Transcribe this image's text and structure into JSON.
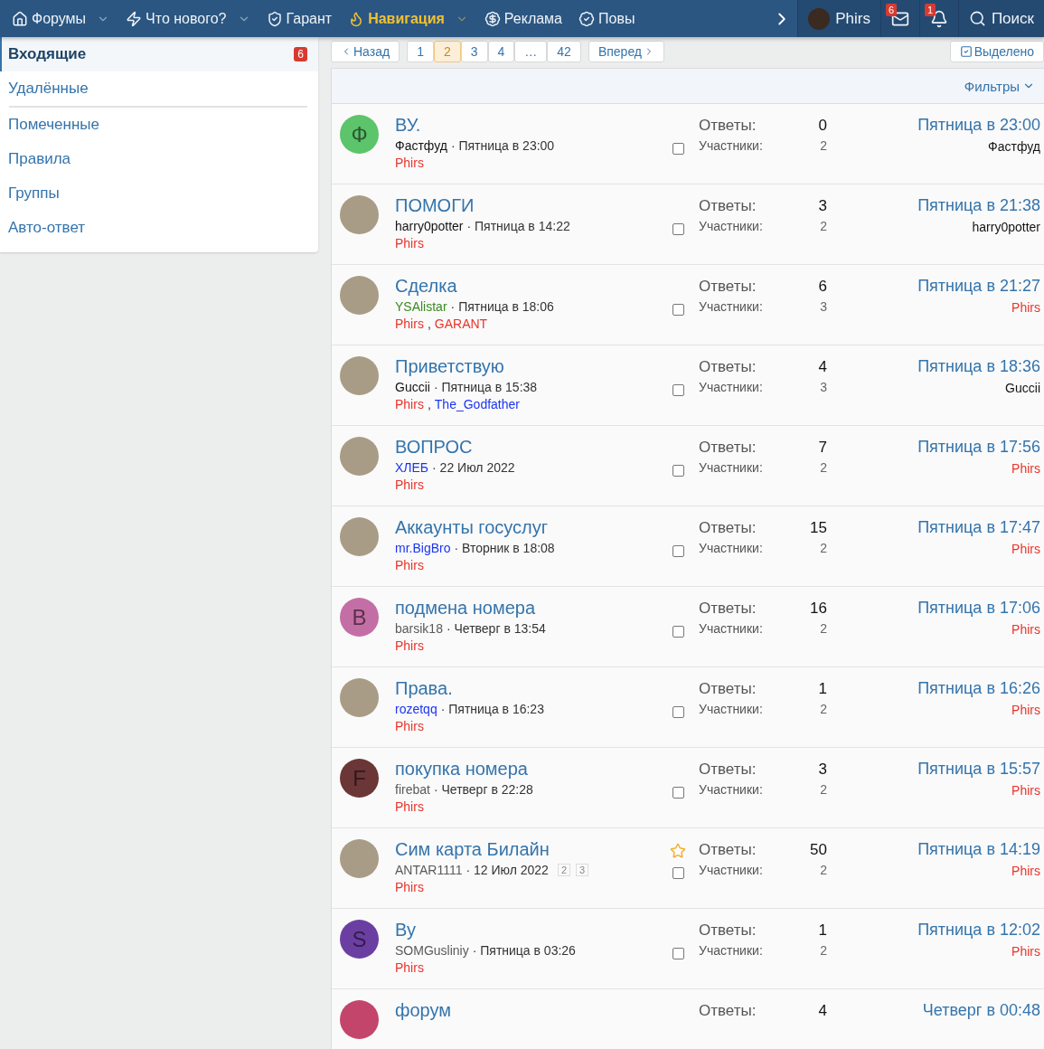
{
  "nav": {
    "items": [
      {
        "label": "Форумы",
        "caret": true,
        "selected": false
      },
      {
        "label": "Что нового?",
        "caret": true,
        "selected": false
      },
      {
        "label": "Гарант",
        "caret": false,
        "selected": false
      },
      {
        "label": "Навигация",
        "caret": true,
        "selected": true
      },
      {
        "label": "Реклама",
        "caret": false,
        "selected": false
      },
      {
        "label": "Повы",
        "caret": false,
        "selected": false
      }
    ],
    "user": {
      "name": "Phirs"
    },
    "messages_badge": "6",
    "alerts_badge": "1",
    "search": "Поиск"
  },
  "sidebar": {
    "items": [
      {
        "label": "Входящие",
        "badge": "6",
        "selected": true
      },
      {
        "label": "Удалённые",
        "selected": false
      },
      {
        "label": "Помеченные",
        "selected": false
      },
      {
        "label": "Правила",
        "selected": false
      },
      {
        "label": "Группы",
        "selected": false
      },
      {
        "label": "Авто-ответ",
        "selected": false
      }
    ]
  },
  "pagination": {
    "prev": "Назад",
    "pages": [
      {
        "label": "1",
        "selected": false
      },
      {
        "label": "2",
        "selected": true
      },
      {
        "label": "3",
        "selected": false
      },
      {
        "label": "4",
        "selected": false
      },
      {
        "label": "…",
        "selected": false
      },
      {
        "label": "42",
        "selected": false
      }
    ],
    "next": "Вперед",
    "selected_button": "Выделено"
  },
  "filters": "Фильтры",
  "rows": [
    {
      "title": "ВУ.",
      "avatar": {
        "kind": "letter",
        "letter": "Ф",
        "color": "#5cc46a"
      },
      "author": {
        "name": "Фастфуд",
        "color": "#141414"
      },
      "date": "· Пятница в 23:00",
      "participants": [
        {
          "name": "Phirs",
          "color": "#e8342b"
        }
      ],
      "starred": false,
      "checked": false,
      "replies_label": "Ответы:",
      "replies": "0",
      "members_label": "Участники:",
      "members": "2",
      "last_time": "Пятница в 23:00",
      "last_poster": {
        "name": "Фастфуд",
        "color": "#141414"
      }
    },
    {
      "title": "ПОМОГИ",
      "avatar": {
        "kind": "photo"
      },
      "author": {
        "name": "harry0potter",
        "color": "#141414"
      },
      "date": "· Пятница в 14:22",
      "participants": [
        {
          "name": "Phirs",
          "color": "#e8342b"
        }
      ],
      "starred": false,
      "checked": false,
      "replies_label": "Ответы:",
      "replies": "3",
      "members_label": "Участники:",
      "members": "2",
      "last_time": "Пятница в 21:38",
      "last_poster": {
        "name": "harry0potter",
        "color": "#141414"
      }
    },
    {
      "title": "Сделка",
      "avatar": {
        "kind": "photo"
      },
      "author": {
        "name": "YSAlistar",
        "color": "#3a8a22"
      },
      "date": "· Пятница в 18:06",
      "participants": [
        {
          "name": "Phirs",
          "color": "#e8342b"
        },
        {
          "sep": ",",
          "name": "GARANT",
          "color": "#e8342b"
        }
      ],
      "starred": false,
      "checked": false,
      "replies_label": "Ответы:",
      "replies": "6",
      "members_label": "Участники:",
      "members": "3",
      "last_time": "Пятница в 21:27",
      "last_poster": {
        "name": "Phirs",
        "color": "#e8342b"
      }
    },
    {
      "title": "Приветствую",
      "avatar": {
        "kind": "photo"
      },
      "author": {
        "name": "Guccii",
        "color": "#141414"
      },
      "date": "· Пятница в 15:38",
      "participants": [
        {
          "name": "Phirs",
          "color": "#e8342b"
        },
        {
          "sep": ",",
          "name": "The_Godfather",
          "color": "#1a35f0"
        }
      ],
      "starred": false,
      "checked": false,
      "replies_label": "Ответы:",
      "replies": "4",
      "members_label": "Участники:",
      "members": "3",
      "last_time": "Пятница в 18:36",
      "last_poster": {
        "name": "Guccii",
        "color": "#141414"
      }
    },
    {
      "title": "ВОПРОС",
      "avatar": {
        "kind": "photo"
      },
      "author": {
        "name": "ХЛЕБ",
        "color": "#1a35f0"
      },
      "date": "· 22 Июл 2022",
      "participants": [
        {
          "name": "Phirs",
          "color": "#e8342b"
        }
      ],
      "starred": false,
      "checked": false,
      "replies_label": "Ответы:",
      "replies": "7",
      "members_label": "Участники:",
      "members": "2",
      "last_time": "Пятница в 17:56",
      "last_poster": {
        "name": "Phirs",
        "color": "#e8342b"
      }
    },
    {
      "title": "Аккаунты госуслуг",
      "avatar": {
        "kind": "photo"
      },
      "author": {
        "name": "mr.BigBro",
        "color": "#1a35f0"
      },
      "date": "· Вторник в 18:08",
      "participants": [
        {
          "name": "Phirs",
          "color": "#e8342b"
        }
      ],
      "starred": false,
      "checked": false,
      "replies_label": "Ответы:",
      "replies": "15",
      "members_label": "Участники:",
      "members": "2",
      "last_time": "Пятница в 17:47",
      "last_poster": {
        "name": "Phirs",
        "color": "#e8342b"
      }
    },
    {
      "title": "подмена номера",
      "avatar": {
        "kind": "letter",
        "letter": "B",
        "color": "#c46ea6"
      },
      "author": {
        "name": "barsik18",
        "color": "#5a5a5a"
      },
      "date": "· Четверг в 13:54",
      "participants": [
        {
          "name": "Phirs",
          "color": "#e8342b"
        }
      ],
      "starred": false,
      "checked": false,
      "replies_label": "Ответы:",
      "replies": "16",
      "members_label": "Участники:",
      "members": "2",
      "last_time": "Пятница в 17:06",
      "last_poster": {
        "name": "Phirs",
        "color": "#e8342b"
      }
    },
    {
      "title": "Права.",
      "avatar": {
        "kind": "photo"
      },
      "author": {
        "name": "rozetqq",
        "color": "#1a35f0"
      },
      "date": "· Пятница в 16:23",
      "participants": [
        {
          "name": "Phirs",
          "color": "#e8342b"
        }
      ],
      "starred": false,
      "checked": false,
      "replies_label": "Ответы:",
      "replies": "1",
      "members_label": "Участники:",
      "members": "2",
      "last_time": "Пятница в 16:26",
      "last_poster": {
        "name": "Phirs",
        "color": "#e8342b"
      }
    },
    {
      "title": "покупка номера",
      "avatar": {
        "kind": "letter",
        "letter": "F",
        "color": "#6b3636"
      },
      "author": {
        "name": "firebat",
        "color": "#5a5a5a"
      },
      "date": "· Четверг в 22:28",
      "participants": [
        {
          "name": "Phirs",
          "color": "#e8342b"
        }
      ],
      "starred": false,
      "checked": false,
      "replies_label": "Ответы:",
      "replies": "3",
      "members_label": "Участники:",
      "members": "2",
      "last_time": "Пятница в 15:57",
      "last_poster": {
        "name": "Phirs",
        "color": "#e8342b"
      }
    },
    {
      "title": "Сим карта Билайн",
      "avatar": {
        "kind": "photo"
      },
      "author": {
        "name": "ANTAR1111",
        "color": "#5a5a5a"
      },
      "date": "· 12 Июл 2022",
      "pages": [
        "2",
        "3"
      ],
      "participants": [
        {
          "name": "Phirs",
          "color": "#e8342b"
        }
      ],
      "starred": true,
      "checked": false,
      "replies_label": "Ответы:",
      "replies": "50",
      "members_label": "Участники:",
      "members": "2",
      "last_time": "Пятница в 14:19",
      "last_poster": {
        "name": "Phirs",
        "color": "#e8342b"
      }
    },
    {
      "title": "Ву",
      "avatar": {
        "kind": "letter",
        "letter": "S",
        "color": "#6b3fa2"
      },
      "author": {
        "name": "SOMGusliniy",
        "color": "#5a5a5a"
      },
      "date": "· Пятница в 03:26",
      "participants": [
        {
          "name": "Phirs",
          "color": "#e8342b"
        }
      ],
      "starred": false,
      "checked": false,
      "replies_label": "Ответы:",
      "replies": "1",
      "members_label": "Участники:",
      "members": "2",
      "last_time": "Пятница в 12:02",
      "last_poster": {
        "name": "Phirs",
        "color": "#e8342b"
      }
    },
    {
      "title": "форум",
      "avatar": {
        "kind": "plain",
        "color": "#c4456c"
      },
      "replies_label": "Ответы:",
      "replies": "4",
      "last_time": "Четверг в 00:48"
    }
  ]
}
